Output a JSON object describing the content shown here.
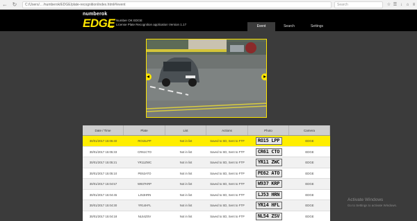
{
  "browser": {
    "url": "C:/Users/... /numberok/EDGE/plate-recognition/index.html#/event",
    "search_placeholder": "Search"
  },
  "header": {
    "brand_top": "numberok",
    "brand_main": "EDGE",
    "subtitle_1": "Number OK EDGE",
    "subtitle_2": "License Plate Recognition application    Version 1.17",
    "tabs": [
      {
        "label": "Event",
        "active": true
      },
      {
        "label": "Search",
        "active": false
      },
      {
        "label": "Settings",
        "active": false
      }
    ]
  },
  "table": {
    "headers": [
      "Date / Time",
      "Plate",
      "List",
      "Actions",
      "Photo",
      "Camera"
    ],
    "rows": [
      {
        "datetime": "30/01/2017 15:05:40",
        "plate": "RO15LPP",
        "list": "Not in list",
        "action": "Saved to SD, Sent to FTP",
        "photo_text": "RO15 LPP",
        "camera": "EDGE",
        "selected": true
      },
      {
        "datetime": "30/01/2017 15:05:33",
        "plate": "CR61CTO",
        "list": "Not in list",
        "action": "Saved to SD, Sent to FTP",
        "photo_text": "CR61 CTO",
        "camera": "EDGE",
        "selected": false
      },
      {
        "datetime": "30/01/2017 15:05:21",
        "plate": "YR11ZWC",
        "list": "Not in list",
        "action": "Saved to SD, Sent to FTP",
        "photo_text": "YR11 ZWC",
        "camera": "EDGE",
        "selected": false
      },
      {
        "datetime": "30/01/2017 15:05:10",
        "plate": "PE62ATO",
        "list": "Not in list",
        "action": "Saved to SD, Sent to FTP",
        "photo_text": "PE62 ATO",
        "camera": "EDGE",
        "selected": false
      },
      {
        "datetime": "30/01/2017 15:04:57",
        "plate": "W937KRP",
        "list": "Not in list",
        "action": "Saved to SD, Sent to FTP",
        "photo_text": "W937 KRP",
        "camera": "EDGE",
        "selected": false
      },
      {
        "datetime": "30/01/2017 15:04:45",
        "plate": "LJ53HRN",
        "list": "Not in list",
        "action": "Saved to SD, Sent to FTP",
        "photo_text": "LJ53 HRN",
        "camera": "EDGE",
        "selected": false
      },
      {
        "datetime": "30/01/2017 15:04:30",
        "plate": "YR14HFL",
        "list": "Not in list",
        "action": "Saved to SD, Sent to FTP",
        "photo_text": "YR14 HFL",
        "camera": "EDGE",
        "selected": false
      },
      {
        "datetime": "30/01/2017 15:04:18",
        "plate": "NL54ZSV",
        "list": "Not in list",
        "action": "Saved to SD, Sent to FTP",
        "photo_text": "NL54 ZSV",
        "camera": "EDGE",
        "selected": false
      }
    ]
  },
  "watermark": {
    "line1": "Activate Windows",
    "line2": "Go to Settings to activate Windows."
  },
  "colors": {
    "accent": "#ffe600",
    "background": "#3b3b3b",
    "header": "#000000"
  }
}
